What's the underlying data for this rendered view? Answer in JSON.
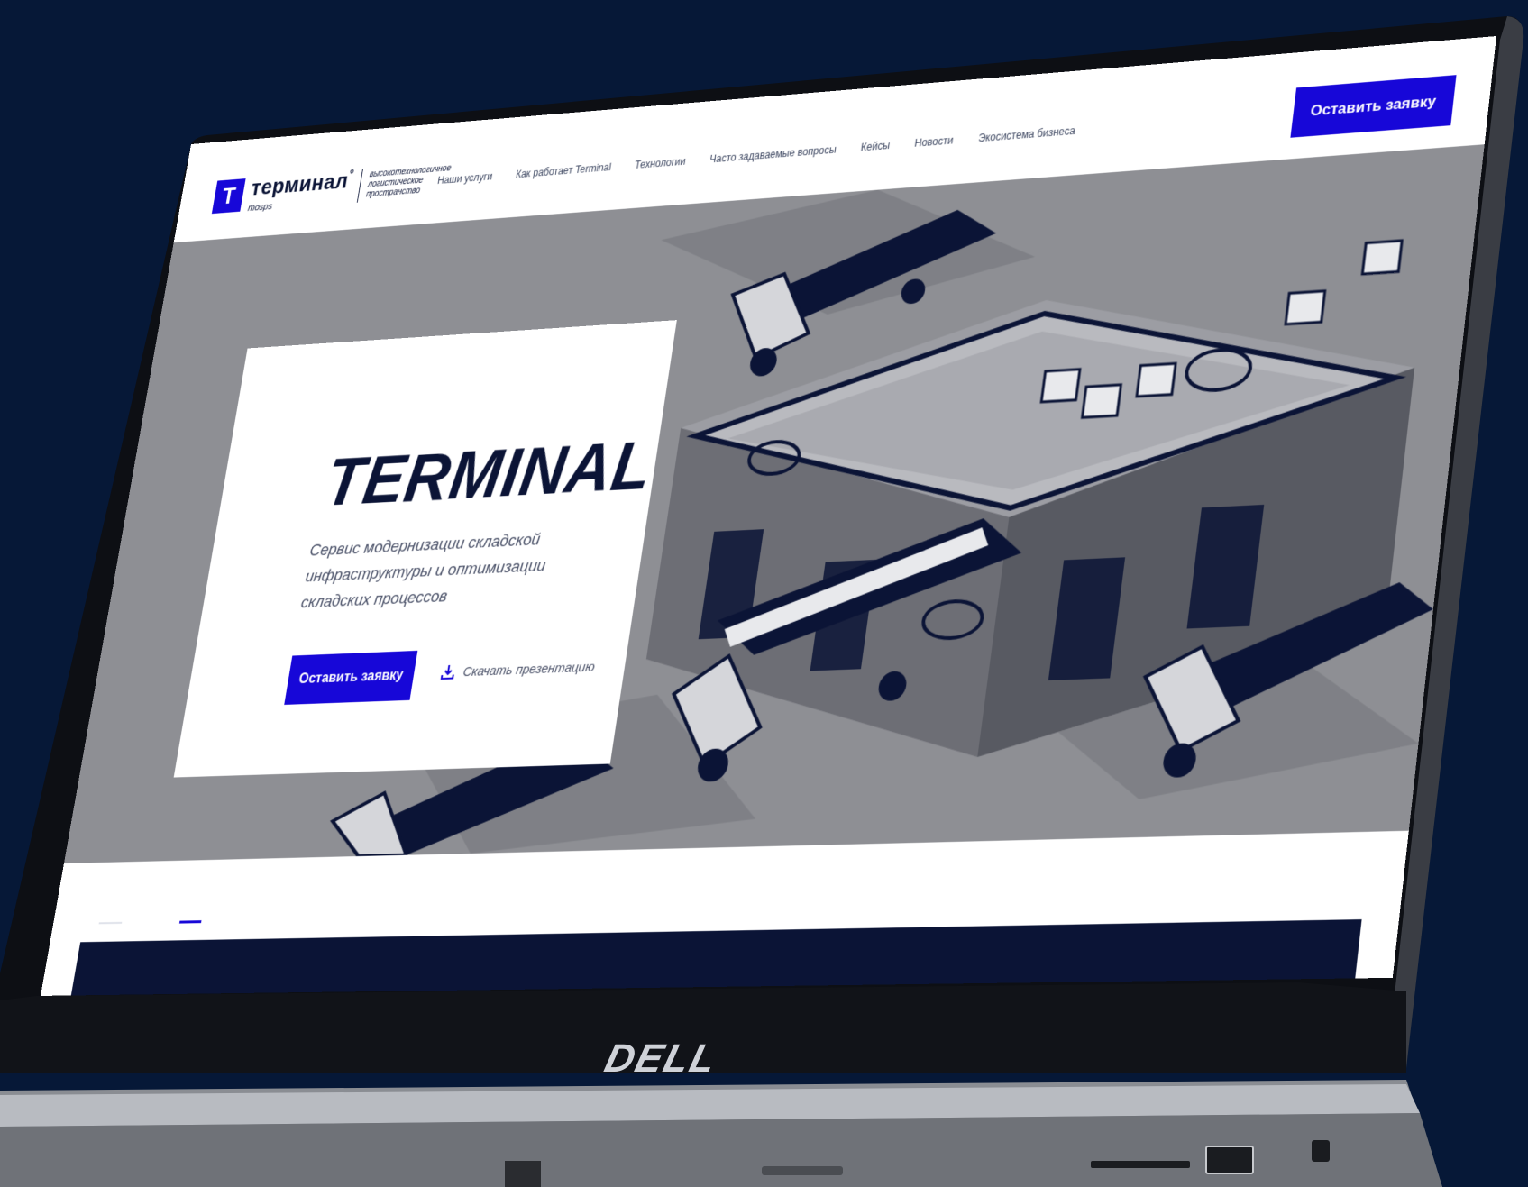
{
  "brand": {
    "logo_letter": "T",
    "name": "терминал",
    "trademark": "°",
    "sub": "mosps",
    "description": "высокотехнологичное логистическое пространство"
  },
  "nav": {
    "items": [
      "Наши услуги",
      "Как работает Terminal",
      "Технологии",
      "Часто задаваемые вопросы",
      "Кейсы",
      "Новости",
      "Экосистема бизнеса"
    ]
  },
  "header": {
    "cta_label": "Оставить заявку"
  },
  "hero": {
    "title": "TERMINAL",
    "subtitle": "Сервис модернизации складской инфраструктуры и оптимизации складских процессов",
    "cta_label": "Оставить заявку",
    "download_label": "Скачать презентацию"
  },
  "device": {
    "brand": "DELL"
  },
  "colors": {
    "background": "#061837",
    "accent": "#1707d8",
    "ink": "#0b1436",
    "illustration_gray": "#8e8f94"
  }
}
